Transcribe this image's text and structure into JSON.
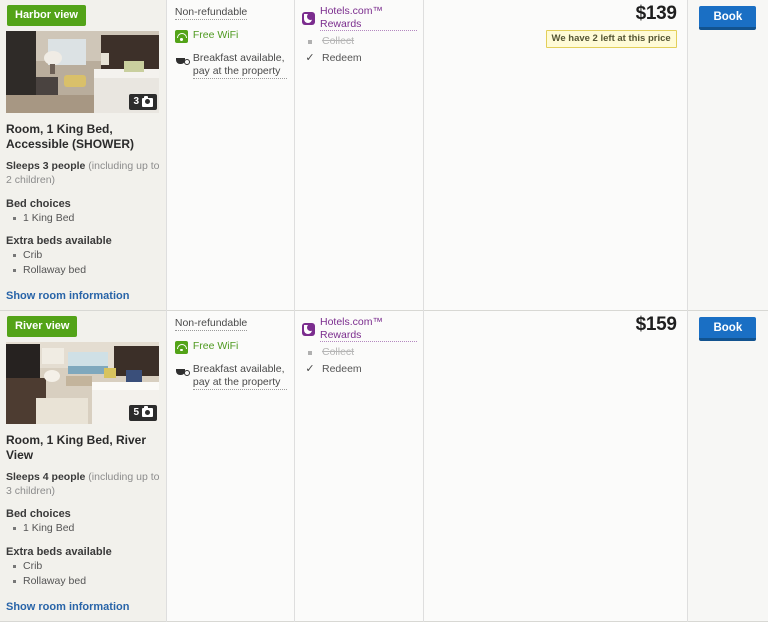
{
  "rooms": [
    {
      "view_badge": "Harbor view",
      "photo_count": "3",
      "title": "Room, 1 King Bed, Accessible (SHOWER)",
      "sleeps_main": "Sleeps 3 people",
      "sleeps_note": "(including up to 2 children)",
      "bed_choices_label": "Bed choices",
      "bed_choices": [
        "1 King Bed"
      ],
      "extra_beds_label": "Extra beds available",
      "extra_beds": [
        "Crib",
        "Rollaway bed"
      ],
      "show_info_link": "Show room information",
      "options": {
        "refund": "Non-refundable",
        "wifi": "Free WiFi",
        "breakfast": "Breakfast available, pay at the property"
      },
      "rewards": {
        "title": "Hotels.com™ Rewards",
        "collect": "Collect",
        "redeem": "Redeem"
      },
      "price": "$139",
      "scarcity": "We have 2 left at this price",
      "book_label": "Book"
    },
    {
      "view_badge": "River view",
      "photo_count": "5",
      "title": "Room, 1 King Bed, River View",
      "sleeps_main": "Sleeps 4 people",
      "sleeps_note": "(including up to 3 children)",
      "bed_choices_label": "Bed choices",
      "bed_choices": [
        "1 King Bed"
      ],
      "extra_beds_label": "Extra beds available",
      "extra_beds": [
        "Crib",
        "Rollaway bed"
      ],
      "show_info_link": "Show room information",
      "options": {
        "refund": "Non-refundable",
        "wifi": "Free WiFi",
        "breakfast": "Breakfast available, pay at the property"
      },
      "rewards": {
        "title": "Hotels.com™ Rewards",
        "collect": "Collect",
        "redeem": "Redeem"
      },
      "price": "$159",
      "scarcity": "",
      "book_label": "Book"
    }
  ],
  "colors": {
    "view_badge_green": "#53a318",
    "book_blue": "#1a6fc4",
    "rewards_purple": "#7b2d8e",
    "link_blue": "#2864a8",
    "scarcity_yellow": "#fffbd6"
  },
  "icons": {
    "wifi": "wifi-icon",
    "breakfast": "coffee-cup-icon",
    "rewards": "hotels-rewards-logo-icon",
    "camera": "camera-icon",
    "check": "✓"
  }
}
